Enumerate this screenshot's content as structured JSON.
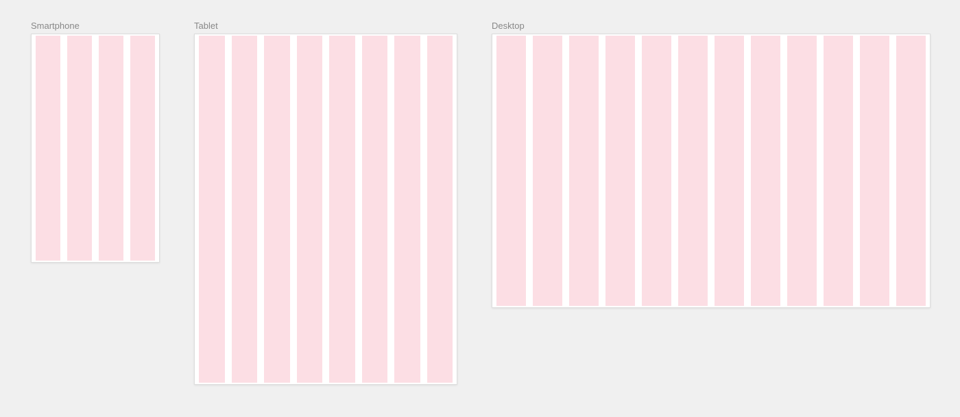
{
  "devices": {
    "smartphone": {
      "label": "Smartphone",
      "columns": 4
    },
    "tablet": {
      "label": "Tablet",
      "columns": 8
    },
    "desktop": {
      "label": "Desktop",
      "columns": 12
    }
  },
  "colors": {
    "column_fill": "#fcdee4",
    "frame_bg": "#ffffff",
    "page_bg": "#f0f0f0"
  }
}
